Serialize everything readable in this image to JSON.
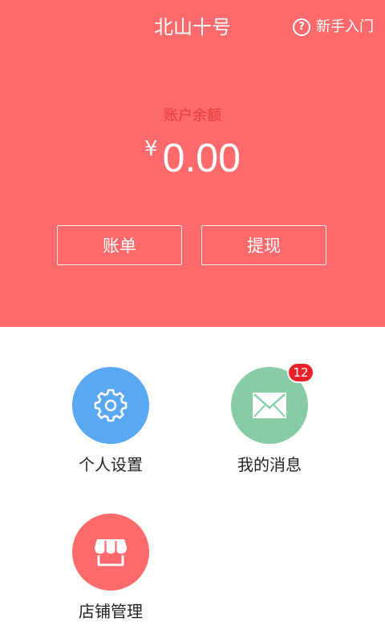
{
  "header": {
    "title": "北山十号",
    "guide_label": "新手入门",
    "guide_icon": "help-circle-icon",
    "bg_color": "#ff6b6d"
  },
  "account": {
    "label": "账户余额",
    "currency": "¥",
    "amount": "0.00"
  },
  "actions": {
    "bill_label": "账单",
    "withdraw_label": "提现"
  },
  "menu": [
    {
      "label": "个人设置",
      "icon": "gear-icon",
      "color": "#5aa7f2"
    },
    {
      "label": "我的消息",
      "icon": "envelope-icon",
      "color": "#87cca4",
      "badge": "12"
    },
    {
      "label": "店铺管理",
      "icon": "store-icon",
      "color": "#ff6b6d"
    }
  ]
}
